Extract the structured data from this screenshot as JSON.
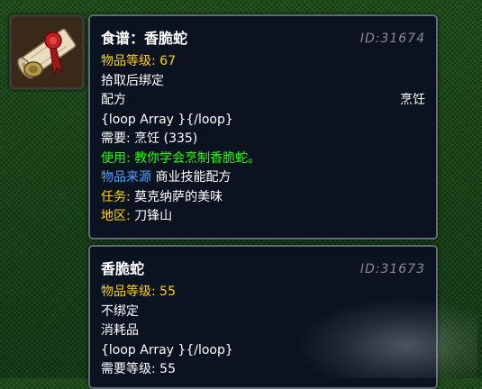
{
  "item_icon": "recipe-scroll-icon",
  "tooltips": [
    {
      "title": "食谱：香脆蛇",
      "id": "ID:31674",
      "item_level_label": "物品等级:",
      "item_level_value": "67",
      "binding": "拾取后绑定",
      "type": "配方",
      "type_right": "烹饪",
      "loop": "{loop Array }{/loop}",
      "requirement": "需要: 烹饪 (335)",
      "use": "使用: 教你学会烹制香脆蛇。",
      "source_label": "物品来源",
      "source_value": "商业技能配方",
      "quest_label": "任务:",
      "quest_value": "莫克纳萨的美味",
      "zone_label": "地区:",
      "zone_value": "刀锋山"
    },
    {
      "title": "香脆蛇",
      "id": "ID:31673",
      "item_level_label": "物品等级:",
      "item_level_value": "55",
      "binding": "不绑定",
      "type": "消耗品",
      "loop": "{loop Array }{/loop}",
      "req_level_label": "需要等级:",
      "req_level_value": "55"
    }
  ],
  "colors": {
    "background": "#1e4a1a",
    "tooltip_bg": "#0c1320",
    "gold": "#ffd100",
    "green": "#1eff00",
    "blue": "#4aa3ff",
    "id_gray": "#8c8c8c"
  }
}
